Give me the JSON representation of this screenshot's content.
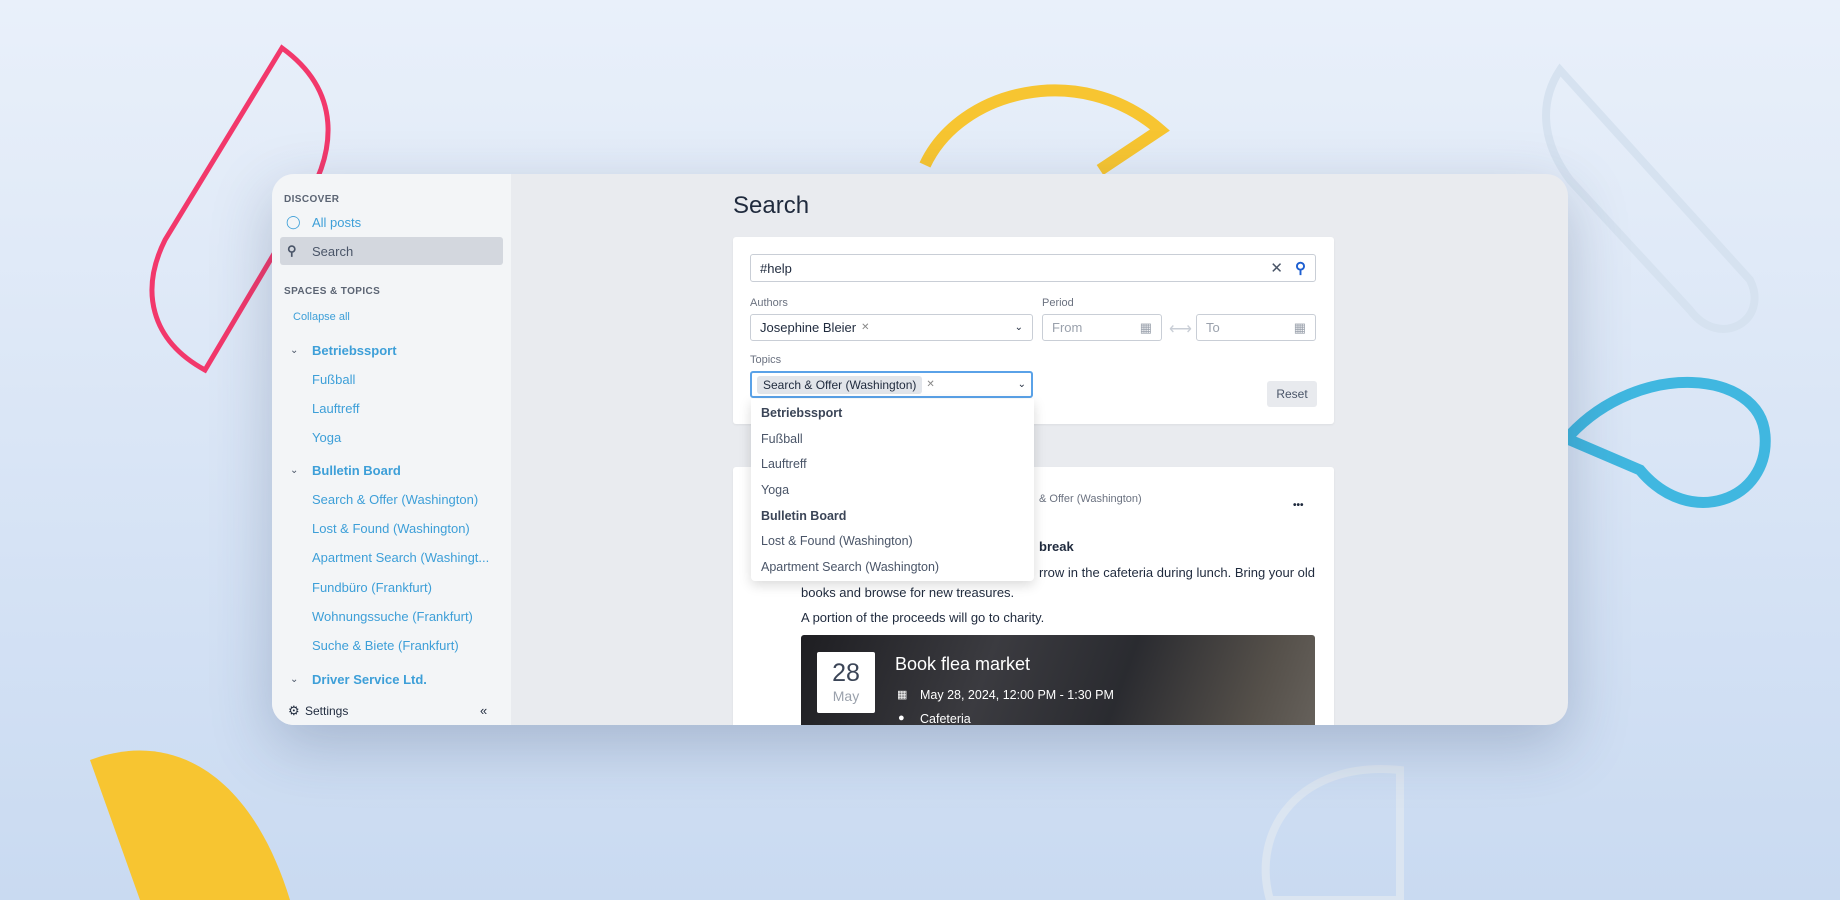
{
  "sidebar": {
    "discover": "DISCOVER",
    "all_posts": "All posts",
    "search": "Search",
    "spaces": "SPACES & TOPICS",
    "collapse": "Collapse all",
    "groups": [
      {
        "name": "Betriebssport",
        "items": [
          "Fußball",
          "Lauftreff",
          "Yoga"
        ]
      },
      {
        "name": "Bulletin Board",
        "items": [
          "Search & Offer (Washington)",
          "Lost & Found (Washington)",
          "Apartment Search (Washingt...",
          "Fundbüro (Frankfurt)",
          "Wohnungssuche (Frankfurt)",
          "Suche & Biete (Frankfurt)"
        ]
      },
      {
        "name": "Driver Service Ltd.",
        "items": []
      }
    ],
    "settings": "Settings",
    "collapse_icon": "«"
  },
  "page": {
    "title": "Search"
  },
  "search": {
    "query": "#help",
    "authors_label": "Authors",
    "author_tag": "Josephine Bleier",
    "period_label": "Period",
    "from_placeholder": "From",
    "to_placeholder": "To",
    "topics_label": "Topics",
    "topic_tag": "Search & Offer (Washington)",
    "reset": "Reset"
  },
  "dropdown": [
    {
      "label": "Betriebssport",
      "group": true
    },
    {
      "label": "Fußball"
    },
    {
      "label": "Lauftreff"
    },
    {
      "label": "Yoga"
    },
    {
      "label": "Bulletin Board",
      "group": true
    },
    {
      "label": "Lost & Found (Washington)"
    },
    {
      "label": "Apartment Search (Washington)"
    }
  ],
  "post": {
    "meta": "& Offer (Washington)",
    "title": "break",
    "line1": "rrow in the cafeteria during lunch. Bring your old",
    "line2": "books and browse for new treasures.",
    "line3": "A portion of the proceeds will go to charity.",
    "more": "•••",
    "event": {
      "day": "28",
      "month": "May",
      "title": "Book flea market",
      "when": "May 28, 2024, 12:00 PM - 1:30 PM",
      "where": "Cafeteria"
    }
  },
  "colors": {
    "accent": "#3d9fd8",
    "rail": "#4aa8dc"
  }
}
